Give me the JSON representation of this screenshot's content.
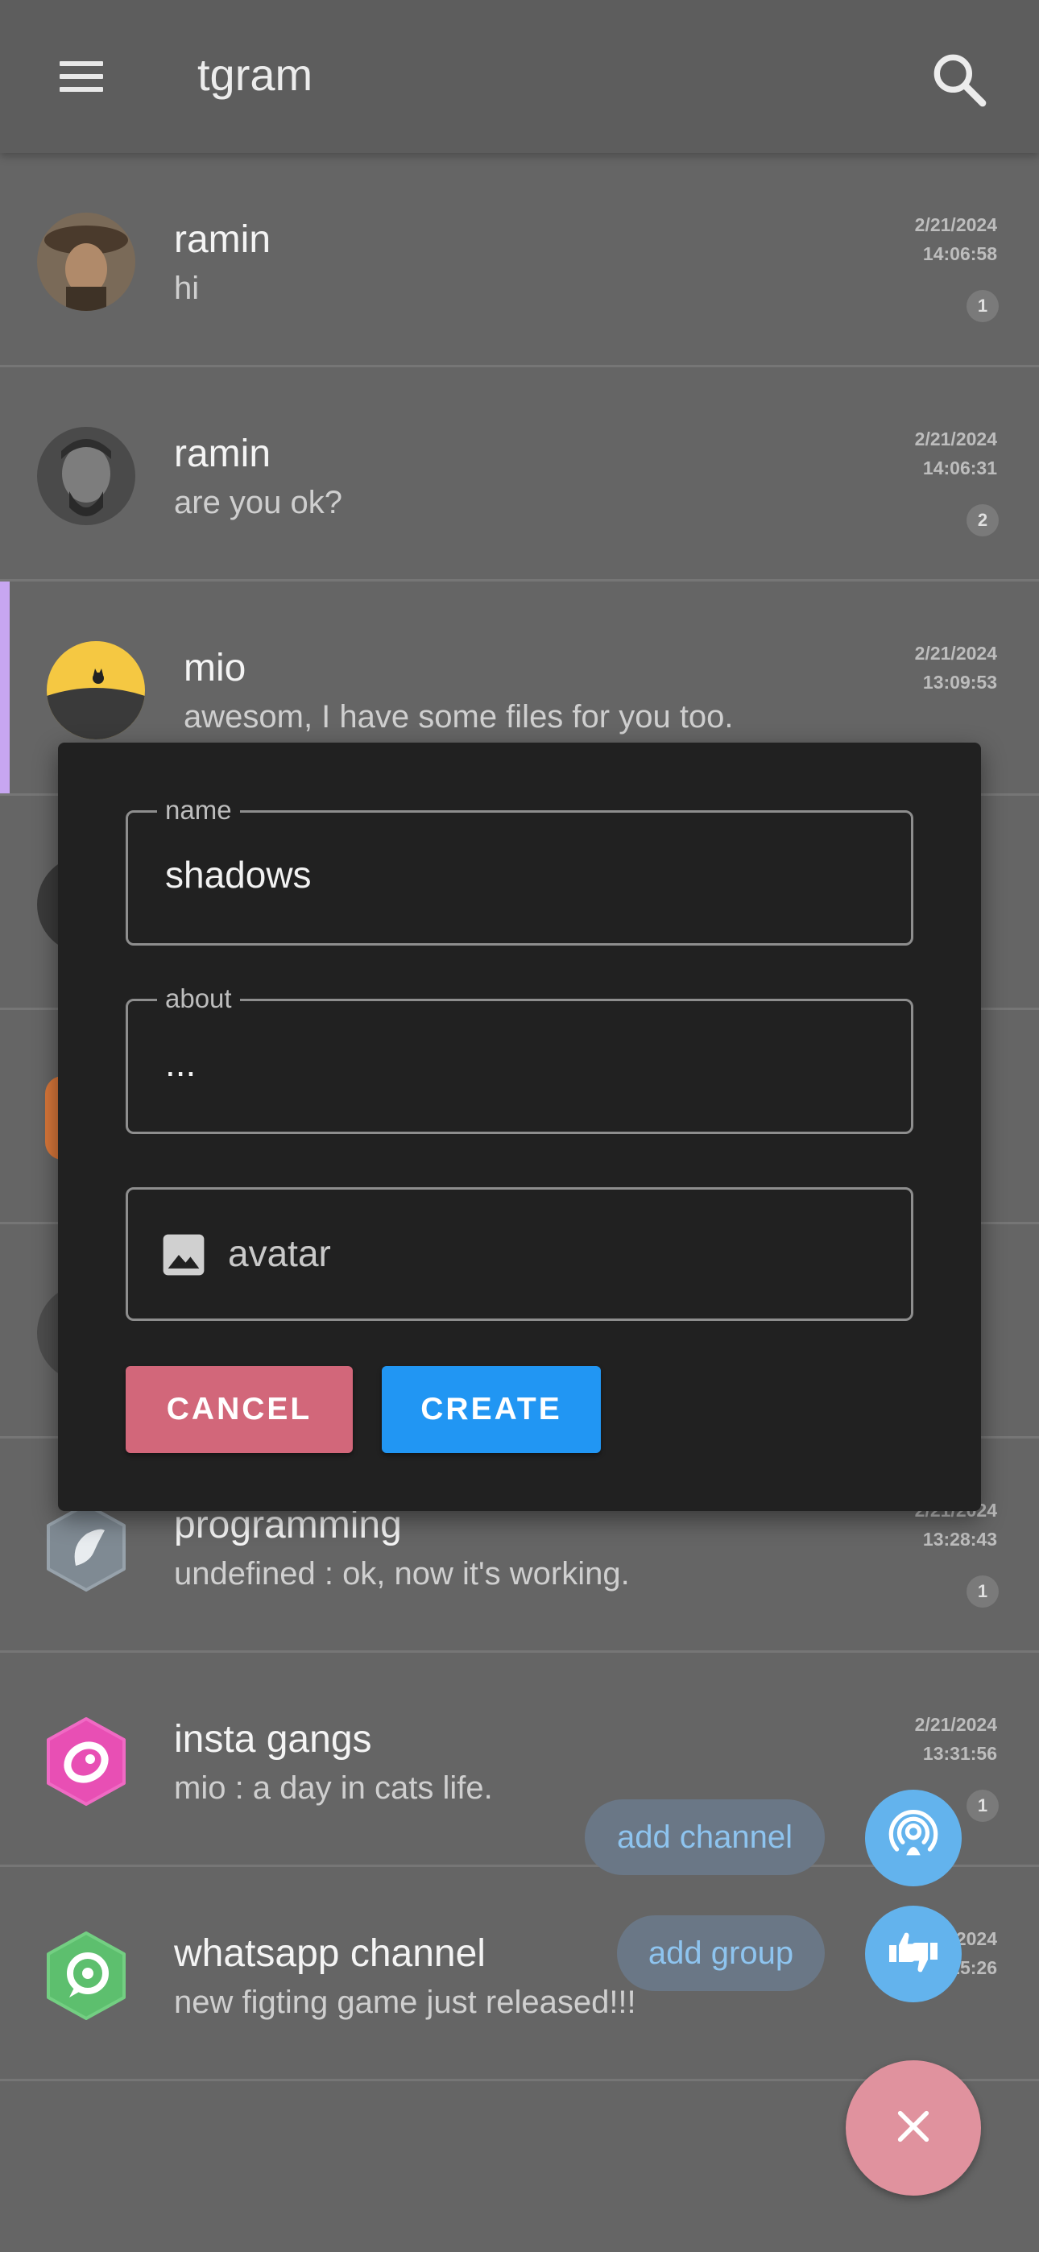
{
  "app": {
    "title": "tgram"
  },
  "chats": [
    {
      "name": "ramin",
      "message": "hi",
      "date": "2/21/2024",
      "time": "14:06:58",
      "unread": "1"
    },
    {
      "name": "ramin",
      "message": "are you ok?",
      "date": "2/21/2024",
      "time": "14:06:31",
      "unread": "2"
    },
    {
      "name": "mio",
      "message": "awesom, I have some files for you too.",
      "date": "2/21/2024",
      "time": "13:09:53",
      "unread": ""
    },
    {
      "name": "programming",
      "message": "undefined : ok, now it's working.",
      "date": "2/21/2024",
      "time": "13:28:43",
      "unread": "1"
    },
    {
      "name": "insta gangs",
      "message": "mio : a day in cats life.",
      "date": "2/21/2024",
      "time": "13:31:56",
      "unread": "1"
    },
    {
      "name": "whatsapp channel",
      "message": "new figting game just released!!!",
      "date": "2/21/2024",
      "time": "13:25:26",
      "unread": ""
    }
  ],
  "dialog": {
    "name_label": "name",
    "name_value": "shadows",
    "about_label": "about",
    "about_value": "...",
    "avatar_label": "avatar",
    "cancel_label": "CANCEL",
    "create_label": "CREATE"
  },
  "fab": {
    "add_channel_label": "add channel",
    "add_group_label": "add group"
  },
  "colors": {
    "cancel": "#d2677a",
    "create": "#2196f3",
    "fab_action": "#63b3ed",
    "fab_main": "#e0929e",
    "active_indicator": "#c7a6f1"
  },
  "icons": [
    "menu-icon",
    "search-icon",
    "image-icon",
    "broadcast-icon",
    "thumbs-icon",
    "close-icon"
  ]
}
